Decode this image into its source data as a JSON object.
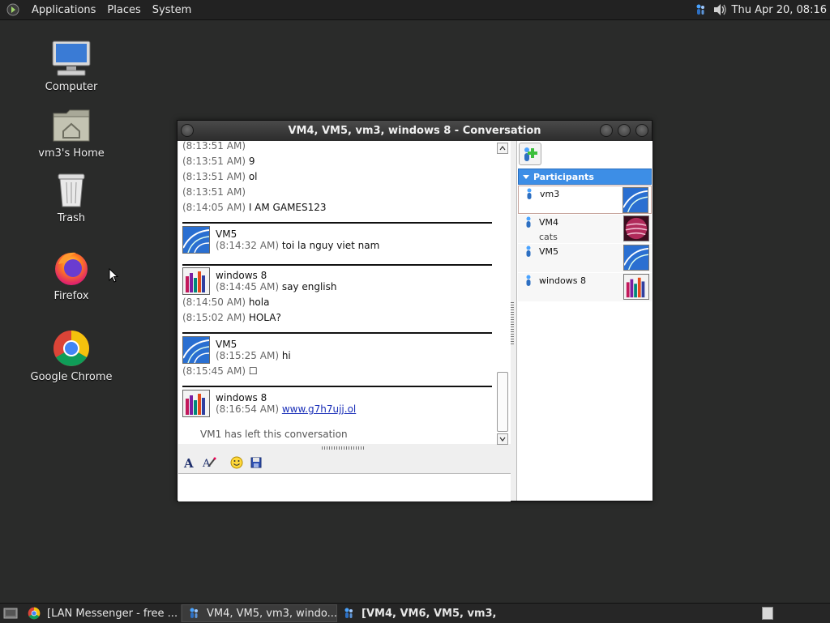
{
  "top_panel": {
    "menus": [
      "Applications",
      "Places",
      "System"
    ],
    "clock": "Thu Apr 20, 08:16",
    "icons": [
      "gnome-foot-icon",
      "lan-messenger-icon",
      "volume-icon"
    ]
  },
  "desktop": {
    "icons": [
      {
        "label": "Computer",
        "icon": "computer-icon"
      },
      {
        "label": "vm3's Home",
        "icon": "home-folder-icon"
      },
      {
        "label": "Trash",
        "icon": "trash-icon"
      },
      {
        "label": "Firefox",
        "icon": "firefox-icon"
      },
      {
        "label": "Google Chrome",
        "icon": "chrome-icon"
      }
    ]
  },
  "window": {
    "title": "VM4, VM5, vm3, windows 8 - Conversation",
    "messages": {
      "pre": [
        {
          "time": "(8:13:51 AM)",
          "text": ""
        },
        {
          "time": "(8:13:51 AM)",
          "text": "9"
        },
        {
          "time": "(8:13:51 AM)",
          "text": "ol"
        },
        {
          "time": "(8:13:51 AM)",
          "text": ""
        },
        {
          "time": "(8:14:05 AM)",
          "text": "I AM GAMES123"
        }
      ],
      "b1": {
        "sender": "VM5",
        "time": "(8:14:32 AM)",
        "text": "toi la nguy viet nam"
      },
      "b2": {
        "sender": "windows 8",
        "time": "(8:14:45 AM)",
        "text": "say english",
        "extra": [
          {
            "time": "(8:14:50 AM)",
            "text": "hola"
          },
          {
            "time": "(8:15:02 AM)",
            "text": "HOLA?"
          }
        ]
      },
      "b3": {
        "sender": "VM5",
        "time": "(8:15:25 AM)",
        "text": "hi",
        "extra": [
          {
            "time": "(8:15:45 AM)",
            "text": "☐"
          }
        ]
      },
      "b4": {
        "sender": "windows 8",
        "time": "(8:16:54 AM)",
        "link": "www.g7h7ujj.ol"
      },
      "status": "VM1 has left this conversation"
    },
    "input_value": "",
    "format_tools": [
      "font-icon",
      "font-color-icon",
      "emoticon-icon",
      "save-icon"
    ],
    "participants_header": "Participants",
    "participants": [
      {
        "name": "vm3",
        "status": ""
      },
      {
        "name": "VM4",
        "status": "cats"
      },
      {
        "name": "VM5",
        "status": ""
      },
      {
        "name": "windows 8",
        "status": ""
      }
    ]
  },
  "taskbar": {
    "tasks": [
      {
        "label": "[LAN Messenger - free ...",
        "icon": "chrome-icon"
      },
      {
        "label": "VM4, VM5, vm3, windo...",
        "icon": "lan-messenger-icon"
      },
      {
        "label": "[VM4, VM6, VM5, vm3,...",
        "icon": "lan-messenger-icon"
      }
    ]
  },
  "colors": {
    "accent": "#3d8ee6",
    "link": "#1a2fb8"
  }
}
